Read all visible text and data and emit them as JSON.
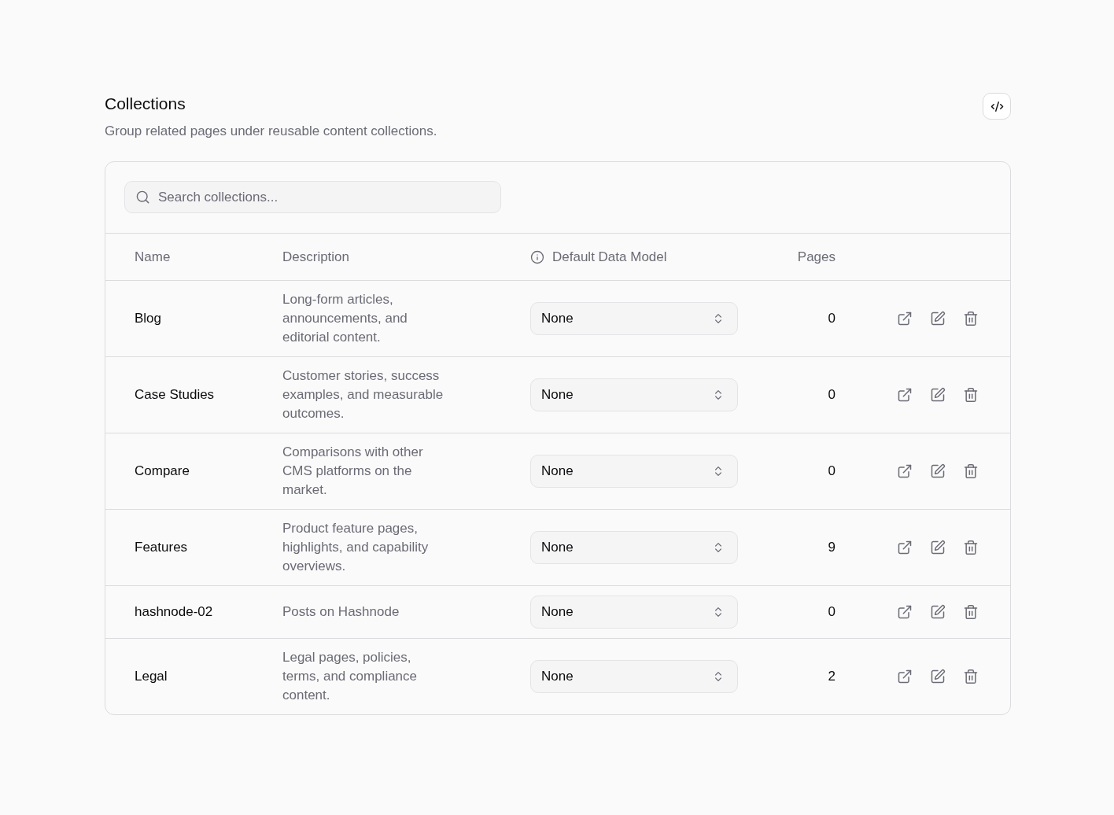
{
  "header": {
    "title": "Collections",
    "subtitle": "Group related pages under reusable content collections."
  },
  "search": {
    "placeholder": "Search collections..."
  },
  "table": {
    "columns": [
      {
        "label": "Name",
        "hint": false
      },
      {
        "label": "Description",
        "hint": false
      },
      {
        "label": "Default Data Model",
        "hint": true
      },
      {
        "label": "Pages",
        "hint": false
      }
    ],
    "rows": [
      {
        "name": "Blog",
        "description": "Long-form articles, announcements, and editorial content.",
        "data_model": "None",
        "pages": "0"
      },
      {
        "name": "Case Studies",
        "description": "Customer stories, success examples, and measurable outcomes.",
        "data_model": "None",
        "pages": "0"
      },
      {
        "name": "Compare",
        "description": "Comparisons with other CMS platforms on the market.",
        "data_model": "None",
        "pages": "0"
      },
      {
        "name": "Features",
        "description": "Product feature pages, highlights, and capability overviews.",
        "data_model": "None",
        "pages": "9"
      },
      {
        "name": "hashnode-02",
        "description": "Posts on Hashnode",
        "data_model": "None",
        "pages": "0"
      },
      {
        "name": "Legal",
        "description": "Legal pages, policies, terms, and compliance content.",
        "data_model": "None",
        "pages": "2"
      }
    ]
  }
}
